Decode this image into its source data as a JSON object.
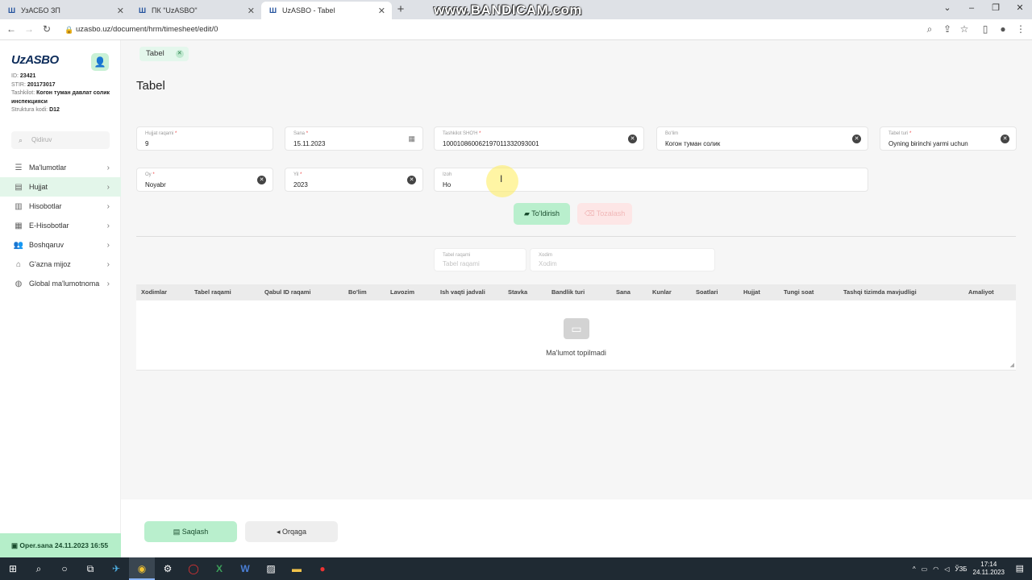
{
  "browser": {
    "tabs": [
      {
        "label": "УзАСБО ЗП",
        "active": false
      },
      {
        "label": "ПК \"UzASBO\"",
        "active": false
      },
      {
        "label": "UzASBO - Tabel",
        "active": true
      }
    ],
    "url": "uzasbo.uz/document/hrm/timesheet/edit/0",
    "watermark": "www.BANDICAM.com"
  },
  "sidebar": {
    "logo": "UzASBO",
    "info": {
      "id_label": "ID:",
      "id_value": "23421",
      "stir_label": "STIR:",
      "stir_value": "201173017",
      "org_label": "Tashkilot:",
      "org_value": "Когон туман давлат солик инспекцияси",
      "struct_label": "Struktura kodi:",
      "struct_value": "D12"
    },
    "search_placeholder": "Qidiruv",
    "menu": [
      {
        "label": "Ma'lumotlar",
        "icon": "list-icon"
      },
      {
        "label": "Hujjat",
        "icon": "document-icon",
        "active": true
      },
      {
        "label": "Hisobotlar",
        "icon": "chart-icon"
      },
      {
        "label": "E-Hisobotlar",
        "icon": "e-report-icon"
      },
      {
        "label": "Boshqaruv",
        "icon": "users-icon"
      },
      {
        "label": "G'azna mijoz",
        "icon": "bank-icon"
      },
      {
        "label": "Global ma'lumotnoma",
        "icon": "globe-icon"
      }
    ],
    "oper_date": "Oper.sana 24.11.2023 16:55"
  },
  "page": {
    "tab_label": "Tabel",
    "title": "Tabel",
    "fields": {
      "doc_number": {
        "label": "Hujjat raqami",
        "value": "9"
      },
      "date": {
        "label": "Sana",
        "value": "15.11.2023"
      },
      "org_account": {
        "label": "Tashkilot SHO'H",
        "value": "100010860062197011332093001"
      },
      "department": {
        "label": "Bo'lim",
        "value": "Когон туман солик"
      },
      "tabel_type": {
        "label": "Tabel turi",
        "value": "Oyning birinchi yarmi uchun"
      },
      "month": {
        "label": "Oy",
        "value": "Noyabr"
      },
      "year": {
        "label": "Yil",
        "value": "2023"
      },
      "comment": {
        "label": "Izoh",
        "value": "Ho"
      }
    },
    "fill_button": "To'ldirish",
    "clear_button": "Tozalash",
    "filters": {
      "tabel_number": {
        "label": "Tabel raqami",
        "placeholder": "Tabel raqami"
      },
      "employee": {
        "label": "Xodim",
        "placeholder": "Xodim"
      }
    },
    "table": {
      "columns": [
        "Xodimlar",
        "Tabel raqami",
        "Qabul ID raqami",
        "Bo'lim",
        "Lavozim",
        "Ish vaqti jadvali",
        "Stavka",
        "Bandlik turi",
        "Sana",
        "Kunlar",
        "Soatlari",
        "Hujjat",
        "Tungi soat",
        "Tashqi tizimda mavjudligi",
        "Amaliyot"
      ],
      "empty_text": "Ma'lumot topilmadi"
    },
    "save_button": "Saqlash",
    "back_button": "Orqaga"
  },
  "taskbar": {
    "lang": "ЎЗБ",
    "time": "17:14",
    "date": "24.11.2023"
  },
  "colors": {
    "accent_green": "#b9efcd",
    "active_menu_bg": "#e3f6ea",
    "brand_navy": "#0d2c5a"
  }
}
